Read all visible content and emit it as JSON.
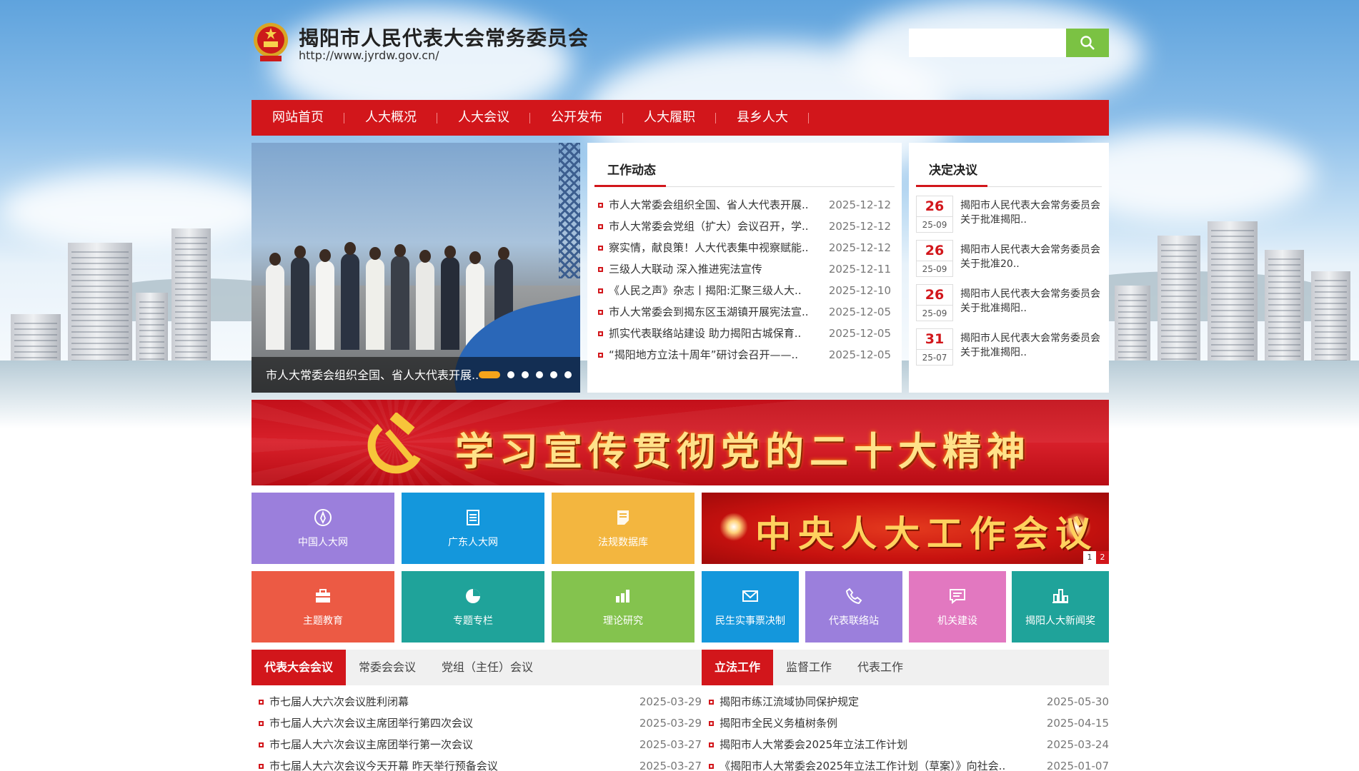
{
  "header": {
    "title": "揭阳市人民代表大会常务委员会",
    "url": "http://www.jyrdw.gov.cn/",
    "search_placeholder": ""
  },
  "nav": {
    "items": [
      "网站首页",
      "人大概况",
      "人大会议",
      "公开发布",
      "人大履职",
      "县乡人大"
    ]
  },
  "slider": {
    "caption": "市人大常委会组织全国、省人大代表开展..",
    "slide_count": 6,
    "active_index": 0
  },
  "work_news": {
    "title": "工作动态",
    "items": [
      {
        "title": "市人大常委会组织全国、省人大代表开展..",
        "date": "2025-12-12"
      },
      {
        "title": "市人大常委会党组（扩大）会议召开，学..",
        "date": "2025-12-12"
      },
      {
        "title": "察实情，献良策！人大代表集中视察赋能..",
        "date": "2025-12-12"
      },
      {
        "title": "三级人大联动 深入推进宪法宣传",
        "date": "2025-12-11"
      },
      {
        "title": "《人民之声》杂志丨揭阳:汇聚三级人大..",
        "date": "2025-12-10"
      },
      {
        "title": "市人大常委会到揭东区玉湖镇开展宪法宣..",
        "date": "2025-12-05"
      },
      {
        "title": "抓实代表联络站建设 助力揭阳古城保育..",
        "date": "2025-12-05"
      },
      {
        "title": "“揭阳地方立法十周年”研讨会召开——..",
        "date": "2025-12-05"
      }
    ]
  },
  "decisions": {
    "title": "决定决议",
    "items": [
      {
        "day": "26",
        "ym": "25-09",
        "text": "揭阳市人民代表大会常务委员会关于批准揭阳.."
      },
      {
        "day": "26",
        "ym": "25-09",
        "text": "揭阳市人民代表大会常务委员会关于批准20.."
      },
      {
        "day": "26",
        "ym": "25-09",
        "text": "揭阳市人民代表大会常务委员会关于批准揭阳.."
      },
      {
        "day": "31",
        "ym": "25-07",
        "text": "揭阳市人民代表大会常务委员会关于批准揭阳.."
      }
    ]
  },
  "banner": {
    "text": "学习宣传贯彻党的二十大精神"
  },
  "tiles": [
    {
      "label": "中国人大网",
      "icon": "compass-icon",
      "color": "#9b7fdc"
    },
    {
      "label": "广东人大网",
      "icon": "document-icon",
      "color": "#1497dc"
    },
    {
      "label": "法规数据库",
      "icon": "notes-icon",
      "color": "#f3b63f"
    },
    {
      "label": "主题教育",
      "icon": "briefcase-icon",
      "color": "#ec5a44"
    },
    {
      "label": "专题专栏",
      "icon": "pie-chart-icon",
      "color": "#1fa39a"
    },
    {
      "label": "理论研究",
      "icon": "bar-chart-icon",
      "color": "#84c34e"
    },
    {
      "label": "民生实事票决制",
      "icon": "mail-icon",
      "color": "#1497dc"
    },
    {
      "label": "代表联络站",
      "icon": "phone-icon",
      "color": "#9b7fdc"
    },
    {
      "label": "机关建设",
      "icon": "message-icon",
      "color": "#e278c0"
    },
    {
      "label": "揭阳人大新闻奖",
      "icon": "column-chart-icon",
      "color": "#1fa39a"
    }
  ],
  "promo": {
    "text": "中央人大工作会议",
    "pages": [
      "1",
      "2"
    ],
    "active_page": "2"
  },
  "left_tabs": {
    "tabs": [
      "代表大会会议",
      "常委会会议",
      "党组（主任）会议"
    ],
    "active": 0,
    "items": [
      {
        "title": "市七届人大六次会议胜利闭幕",
        "date": "2025-03-29"
      },
      {
        "title": "市七届人大六次会议主席团举行第四次会议",
        "date": "2025-03-29"
      },
      {
        "title": "市七届人大六次会议主席团举行第一次会议",
        "date": "2025-03-27"
      },
      {
        "title": "市七届人大六次会议今天开幕 昨天举行预备会议",
        "date": "2025-03-27"
      }
    ]
  },
  "right_tabs": {
    "tabs": [
      "立法工作",
      "监督工作",
      "代表工作"
    ],
    "active": 0,
    "items": [
      {
        "title": "揭阳市练江流域协同保护规定",
        "date": "2025-05-30"
      },
      {
        "title": "揭阳市全民义务植树条例",
        "date": "2025-04-15"
      },
      {
        "title": "揭阳市人大常委会2025年立法工作计划",
        "date": "2025-03-24"
      },
      {
        "title": "《揭阳市人大常委会2025年立法工作计划（草案）》向社会..",
        "date": "2025-01-07"
      }
    ]
  },
  "colors": {
    "brand_red": "#d2161b",
    "search_green": "#7bc243"
  }
}
